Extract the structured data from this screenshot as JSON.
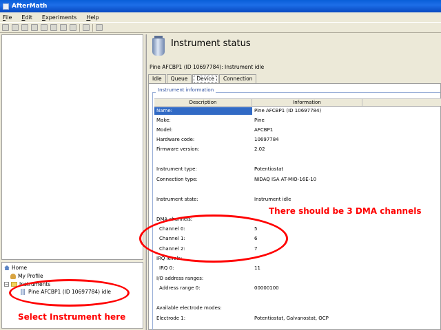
{
  "window": {
    "title": "AfterMath"
  },
  "menu": [
    "File",
    "Edit",
    "Experiments",
    "Help"
  ],
  "tree": {
    "home": "Home",
    "profile": "My Profile",
    "instruments": "Instruments",
    "selected_instrument": "Pine AFCBP1 (ID 10697784) idle"
  },
  "status": {
    "title": "Instrument status",
    "line": "Pine AFCBP1 (ID 10697784): Instrument idle"
  },
  "tabs": [
    "Idle",
    "Queue",
    "Device",
    "Connection"
  ],
  "active_tab": "Device",
  "info": {
    "group_label": "Instrument information",
    "columns": [
      "Description",
      "Information"
    ],
    "rows": [
      {
        "d": "Name:",
        "v": "Pine AFCBP1 (ID 10697784)"
      },
      {
        "d": "Make:",
        "v": "Pine"
      },
      {
        "d": "Model:",
        "v": "AFCBP1"
      },
      {
        "d": "Hardware code:",
        "v": "10697784"
      },
      {
        "d": "Firmware version:",
        "v": "2.02"
      },
      {
        "d": "Instrument type:",
        "v": "Potentiostat"
      },
      {
        "d": "Connection type:",
        "v": "NIDAQ ISA AT-MIO-16E-10"
      },
      {
        "d": "Instrument state:",
        "v": "Instrument idle"
      },
      {
        "d": "DMA channels:",
        "v": ""
      },
      {
        "d": "Channel 0:",
        "v": "5"
      },
      {
        "d": "Channel 1:",
        "v": "6"
      },
      {
        "d": "Channel 2:",
        "v": "7"
      },
      {
        "d": "IRQ levels:",
        "v": ""
      },
      {
        "d": "IRQ 0:",
        "v": "11"
      },
      {
        "d": "I/O address ranges:",
        "v": ""
      },
      {
        "d": "Address range 0:",
        "v": "00000100"
      },
      {
        "d": "Available electrode modes:",
        "v": ""
      },
      {
        "d": "Electrode 1:",
        "v": "Potentiostat, Galvanostat, OCP"
      }
    ]
  },
  "annotations": {
    "dma_note": "There should be 3 DMA channels",
    "select_note": "Select Instrument here"
  },
  "colors": {
    "annotation": "#ff0000",
    "selection": "#316ac5",
    "titlebar": "#0a5fd8"
  }
}
